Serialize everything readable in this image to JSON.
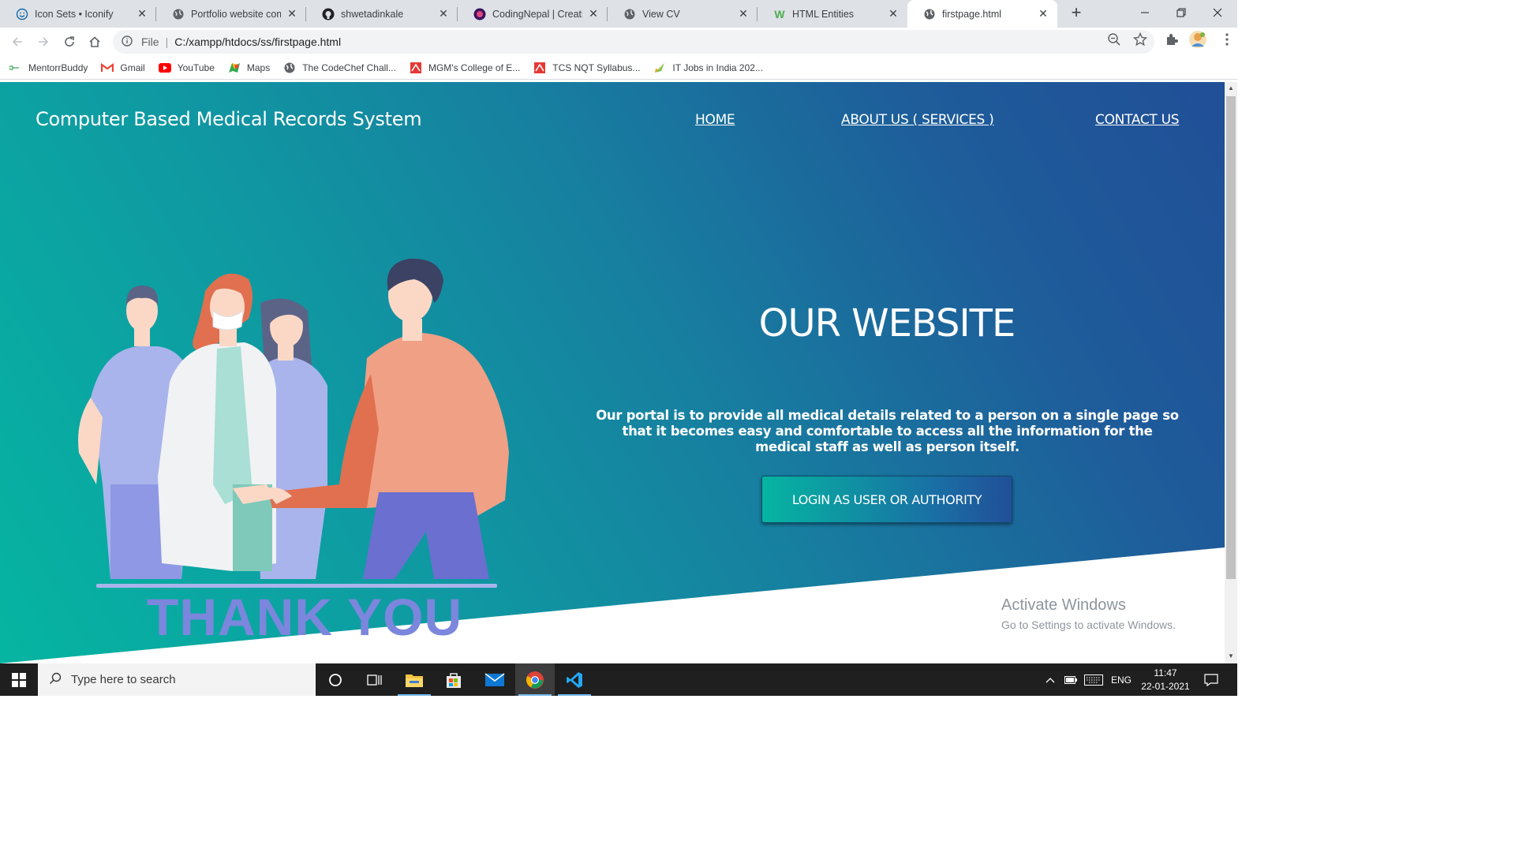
{
  "browser": {
    "tabs": [
      {
        "title": "Icon Sets • Iconify",
        "icon": "smiley-icon"
      },
      {
        "title": "Portfolio website comp",
        "icon": "globe-icon"
      },
      {
        "title": "shwetadinkale",
        "icon": "github-icon"
      },
      {
        "title": "CodingNepal | Creative",
        "icon": "codingnepal-icon"
      },
      {
        "title": "View CV",
        "icon": "globe-icon"
      },
      {
        "title": "HTML Entities",
        "icon": "w3schools-icon"
      },
      {
        "title": "firstpage.html",
        "icon": "globe-icon",
        "active": true
      }
    ],
    "address": {
      "scheme": "File",
      "url": "C:/xampp/htdocs/ss/firstpage.html"
    },
    "bookmarks": [
      {
        "label": "MentorrBuddy",
        "icon": "mentor-icon"
      },
      {
        "label": "Gmail",
        "icon": "gmail-icon"
      },
      {
        "label": "YouTube",
        "icon": "youtube-icon"
      },
      {
        "label": "Maps",
        "icon": "maps-icon"
      },
      {
        "label": "The CodeChef Chall...",
        "icon": "globe-icon"
      },
      {
        "label": "MGM's College of E...",
        "icon": "red-square-icon"
      },
      {
        "label": "TCS NQT Syllabus...",
        "icon": "red-square-icon"
      },
      {
        "label": "IT Jobs in India 202...",
        "icon": "rocket-icon"
      }
    ]
  },
  "page": {
    "site_title": "Computer Based Medical Records System",
    "nav": {
      "home": "HOME",
      "about": "ABOUT US ( SERVICES )",
      "contact": "CONTACT US"
    },
    "heading": "OUR WEBSITE",
    "description": "Our portal is to provide all medical details related to a person on a single page so that it becomes easy and comfortable to access all the information for the medical staff as well as person itself.",
    "cta_label": "LOGIN AS USER OR AUTHORITY",
    "illustration_caption": "THANK YOU",
    "colors": {
      "gradient_start": "#05b5a1",
      "gradient_end": "#214f98",
      "caption": "#7b86dd"
    }
  },
  "watermark": {
    "line1": "Activate Windows",
    "line2": "Go to Settings to activate Windows."
  },
  "taskbar": {
    "search_placeholder": "Type here to search",
    "language": "ENG",
    "time": "11:47",
    "date": "22-01-2021"
  }
}
